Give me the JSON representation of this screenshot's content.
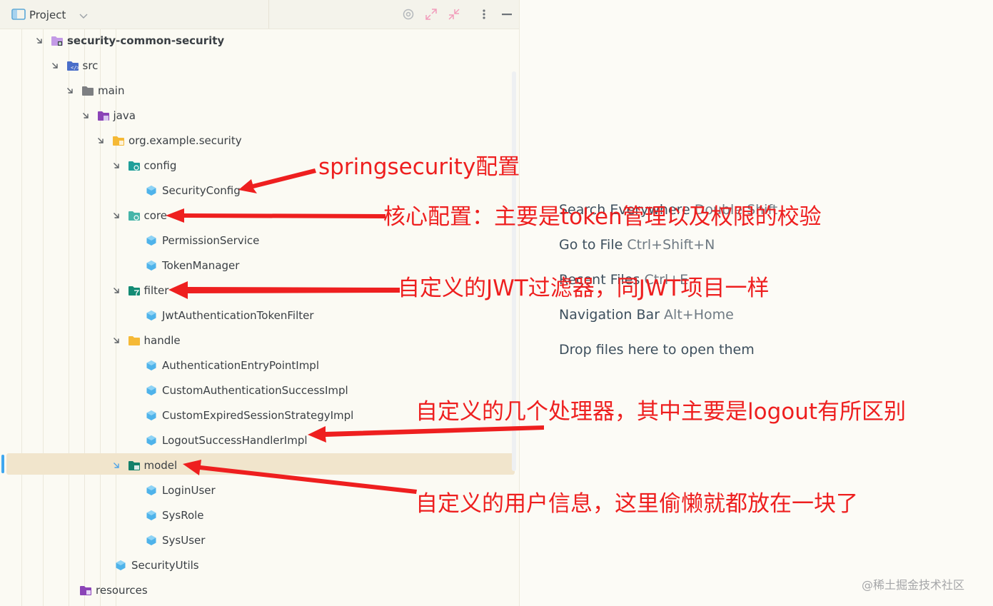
{
  "panel": {
    "title": "Project"
  },
  "colors": {
    "folder_gray": "#7d7f82",
    "folder_module": "#c39ae6",
    "folder_purple": "#8b44b7",
    "folder_yellow": "#f5b936",
    "folder_teal": "#1f9f9a",
    "folder_src": "#4a6ec9",
    "class_blue": "#4fb3ea",
    "annotation_red": "#ee1f1f",
    "selection": "#f1e5cc"
  },
  "tree": [
    {
      "label": "security-common-security",
      "depth": 0,
      "icon": "module-folder-icon",
      "expanded": true,
      "bold": true
    },
    {
      "label": "src",
      "depth": 1,
      "icon": "source-folder-icon",
      "expanded": true
    },
    {
      "label": "main",
      "depth": 2,
      "icon": "folder-icon",
      "expanded": true
    },
    {
      "label": "java",
      "depth": 3,
      "icon": "java-source-root-icon",
      "expanded": true
    },
    {
      "label": "org.example.security",
      "depth": 4,
      "icon": "package-icon",
      "expanded": true
    },
    {
      "label": "config",
      "depth": 5,
      "icon": "config-package-icon",
      "expanded": true
    },
    {
      "label": "SecurityConfig",
      "depth": 6,
      "icon": "class-icon"
    },
    {
      "label": "core",
      "depth": 5,
      "icon": "core-package-icon",
      "expanded": true
    },
    {
      "label": "PermissionService",
      "depth": 6,
      "icon": "class-icon"
    },
    {
      "label": "TokenManager",
      "depth": 6,
      "icon": "class-icon"
    },
    {
      "label": "filter",
      "depth": 5,
      "icon": "filter-package-icon",
      "expanded": true
    },
    {
      "label": "JwtAuthenticationTokenFilter",
      "depth": 6,
      "icon": "class-icon"
    },
    {
      "label": "handle",
      "depth": 5,
      "icon": "yellow-folder-icon",
      "expanded": true
    },
    {
      "label": "AuthenticationEntryPointImpl",
      "depth": 6,
      "icon": "class-icon"
    },
    {
      "label": "CustomAuthenticationSuccessImpl",
      "depth": 6,
      "icon": "class-icon"
    },
    {
      "label": "CustomExpiredSessionStrategyImpl",
      "depth": 6,
      "icon": "class-icon"
    },
    {
      "label": "LogoutSuccessHandlerImpl",
      "depth": 6,
      "icon": "class-icon"
    },
    {
      "label": "model",
      "depth": 5,
      "icon": "model-package-icon",
      "expanded": true,
      "selected": true
    },
    {
      "label": "LoginUser",
      "depth": 6,
      "icon": "class-icon"
    },
    {
      "label": "SysRole",
      "depth": 6,
      "icon": "class-icon"
    },
    {
      "label": "SysUser",
      "depth": 6,
      "icon": "class-icon"
    },
    {
      "label": "SecurityUtils",
      "depth": 5,
      "icon": "class-icon"
    },
    {
      "label": "resources",
      "depth": 3,
      "icon": "resources-folder-icon"
    }
  ],
  "editor_hints": [
    {
      "text": "Search Everywhere ",
      "key": "Double Shift"
    },
    {
      "text": "Go to File ",
      "key": "Ctrl+Shift+N"
    },
    {
      "text": "Recent Files ",
      "key": "Ctrl+E"
    },
    {
      "text": "Navigation Bar ",
      "key": "Alt+Home"
    },
    {
      "text": "Drop files here to open them",
      "key": ""
    }
  ],
  "annotations": [
    {
      "text": "springsecurity配置"
    },
    {
      "text": "核心配置：主要是token管理以及权限的校验"
    },
    {
      "text": "自定义的JWT过滤器，同JWT项目一样"
    },
    {
      "text": "自定义的几个处理器，其中主要是logout有所区别"
    },
    {
      "text": "自定义的用户信息，这里偷懒就都放在一块了"
    }
  ],
  "watermark": "@稀土掘金技术社区"
}
